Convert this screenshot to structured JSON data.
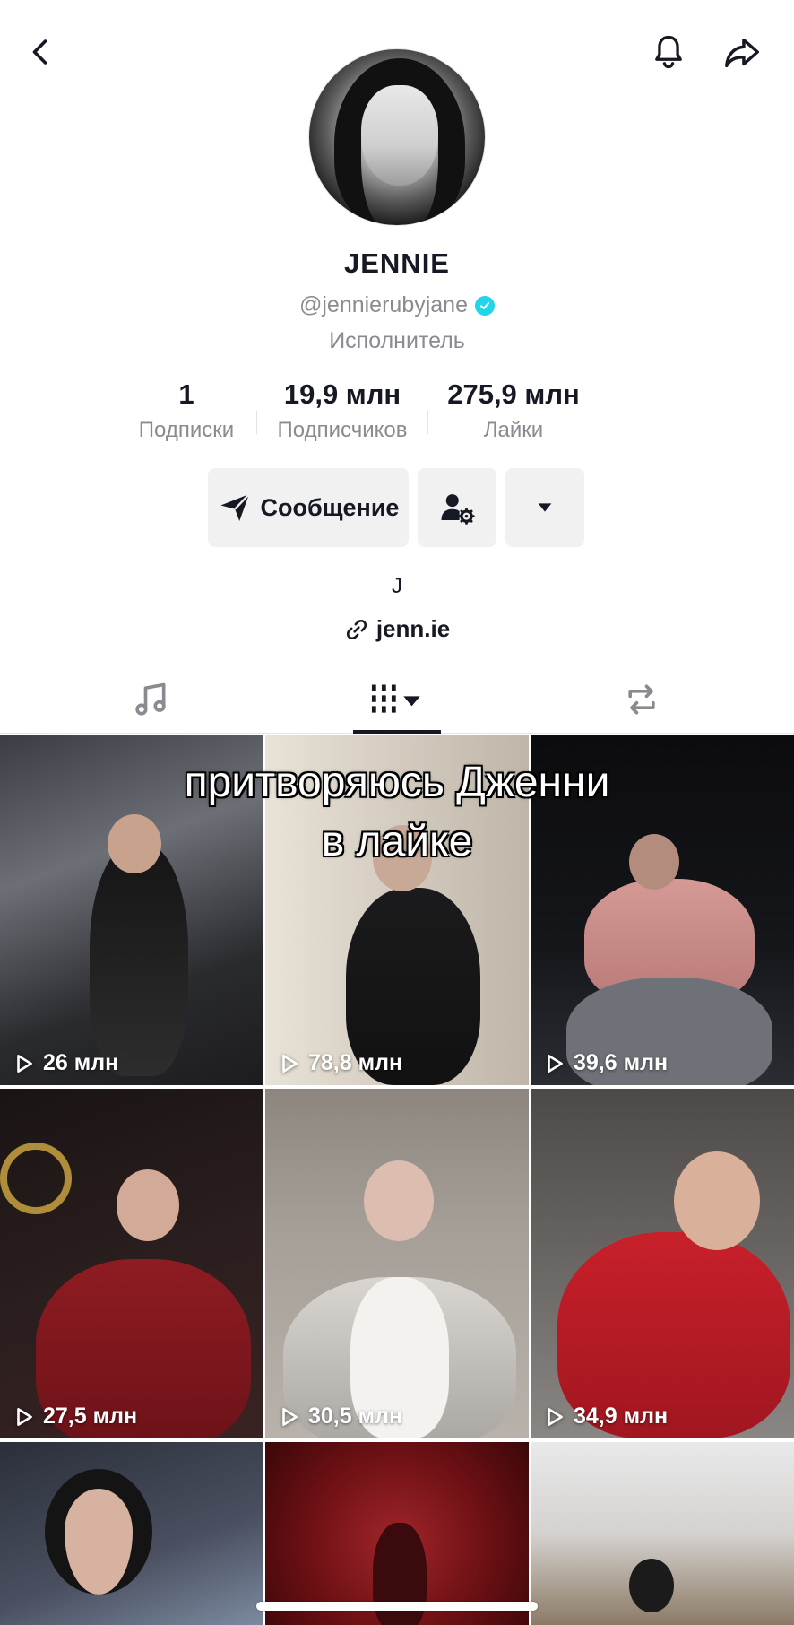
{
  "header": {
    "back_icon": "chevron-left-icon",
    "bell_icon": "bell-icon",
    "share_icon": "share-arrow-icon"
  },
  "profile": {
    "name": "JENNIE",
    "username": "@jennierubyjane",
    "category": "Исполнитель",
    "verified_color": "#20d5ec"
  },
  "stats": [
    {
      "value": "1",
      "label": "Подписки"
    },
    {
      "value": "19,9 млн",
      "label": "Подписчиков"
    },
    {
      "value": "275,9 млн",
      "label": "Лайки"
    }
  ],
  "actions": {
    "message_label": "Сообщение"
  },
  "bio": {
    "text": "J",
    "link": "jenn.ie"
  },
  "tabs": [
    "sounds",
    "videos",
    "reposts"
  ],
  "caption_overlay": {
    "line1": "притворяюсь Дженни",
    "line2": "в лайке"
  },
  "videos": [
    {
      "views": "26 млн"
    },
    {
      "views": "78,8 млн"
    },
    {
      "views": "39,6 млн"
    },
    {
      "views": "27,5 млн"
    },
    {
      "views": "30,5 млн"
    },
    {
      "views": "34,9 млн"
    }
  ]
}
